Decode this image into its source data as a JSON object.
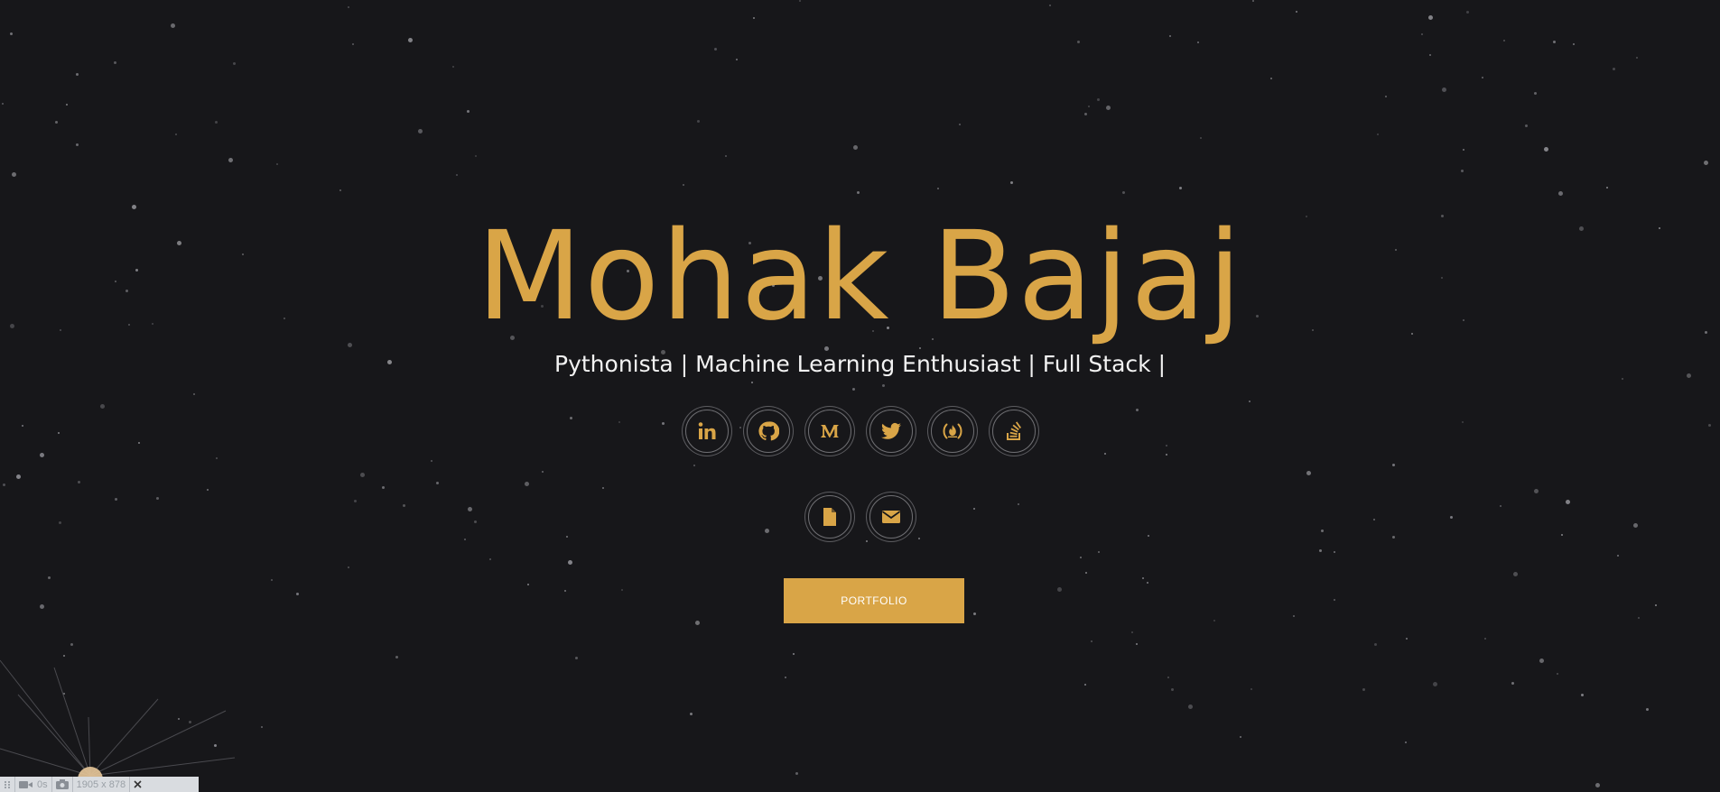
{
  "hero": {
    "name": "Mohak Bajaj",
    "tagline": "Pythonista | Machine Learning Enthusiast | Full Stack |"
  },
  "social_links": [
    {
      "icon": "linkedin-icon"
    },
    {
      "icon": "github-icon"
    },
    {
      "icon": "medium-icon"
    },
    {
      "icon": "twitter-icon"
    },
    {
      "icon": "freecodecamp-icon"
    },
    {
      "icon": "stackoverflow-icon"
    }
  ],
  "contact_links": [
    {
      "icon": "file-icon"
    },
    {
      "icon": "envelope-icon"
    }
  ],
  "portfolio_button": {
    "label": "PORTFOLIO"
  },
  "capture_toolbar": {
    "timer": "0s",
    "dimensions": "1905 x 878"
  },
  "colors": {
    "background": "#17171a",
    "accent": "#d9a547",
    "text": "#f2f2f2",
    "star": "#8d8d92"
  }
}
